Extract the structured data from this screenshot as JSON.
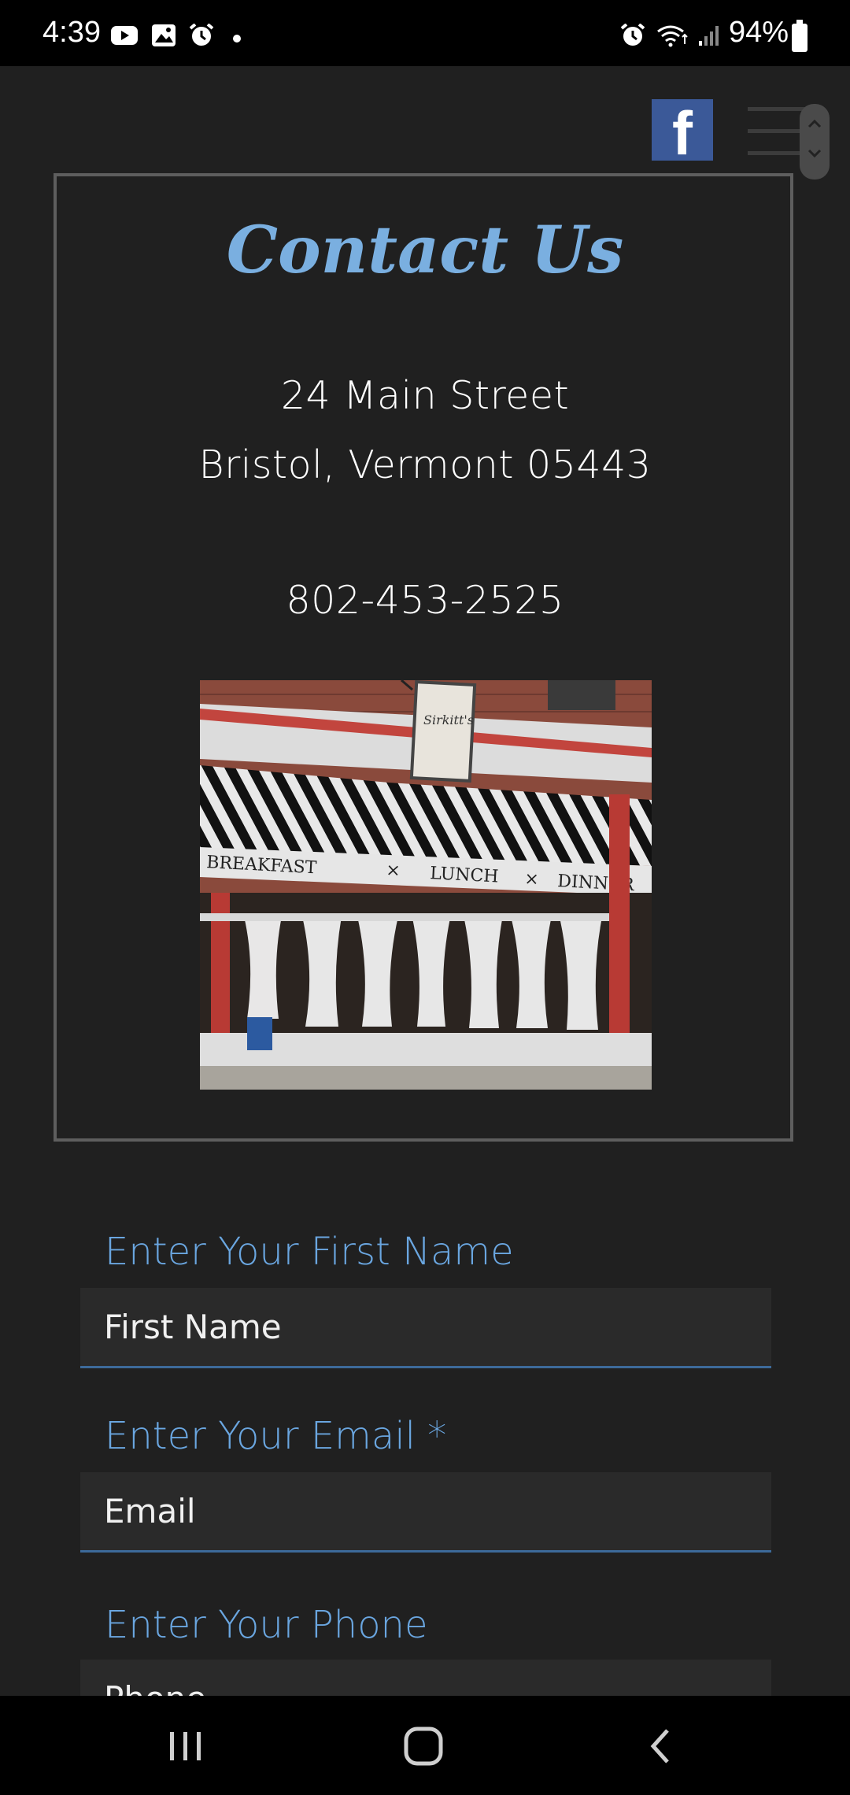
{
  "status_bar": {
    "time": "4:39",
    "battery": "94%",
    "icons": [
      "youtube-icon",
      "gallery-icon",
      "alarm-icon",
      "alarm-icon",
      "wifi-icon",
      "signal-icon",
      "battery-icon"
    ]
  },
  "header": {
    "social_icon": "facebook-icon",
    "social_glyph": "f",
    "menu_icon": "hamburger-menu-icon"
  },
  "contact": {
    "title": "Contact Us",
    "address_line1": "24 Main Street",
    "address_line2": "Bristol, Vermont 05443",
    "phone": "802-453-2525",
    "photo": {
      "awning_text": [
        "BREAKFAST",
        "×",
        "LUNCH",
        "×",
        "DINNER"
      ]
    }
  },
  "form": {
    "first_name": {
      "label": "Enter Your First Name",
      "placeholder": "First Name",
      "value": ""
    },
    "email": {
      "label": "Enter Your Email *",
      "placeholder": "Email",
      "value": ""
    },
    "phone": {
      "label": "Enter Your Phone",
      "placeholder": "Phone",
      "value": ""
    }
  },
  "colors": {
    "background": "#202020",
    "accent": "#7aafe0",
    "field_bg": "#2a2a2a",
    "field_underline": "#3d6a9a"
  }
}
